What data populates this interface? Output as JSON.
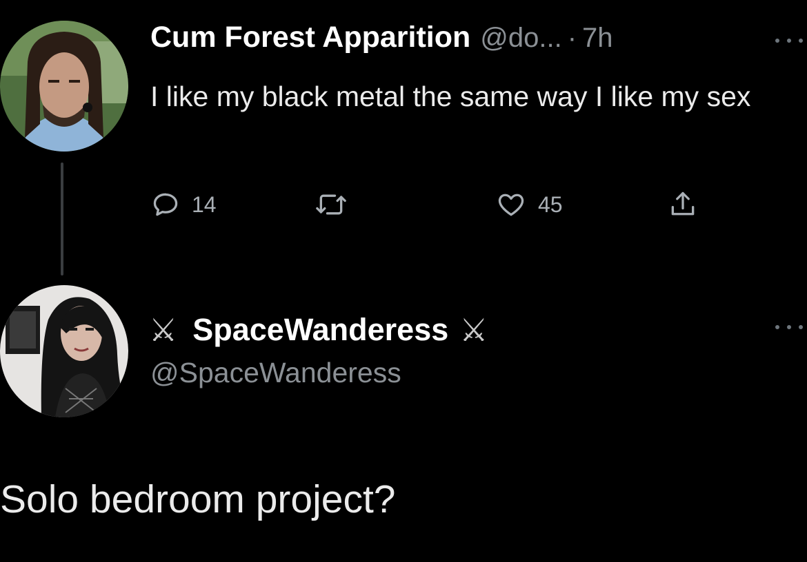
{
  "original_tweet": {
    "author_name": "Cum Forest Apparition",
    "author_handle": "@do...",
    "separator": "·",
    "timestamp": "7h",
    "text": "I like my black metal the same way I like my sex",
    "reply_count": "14",
    "retweet_count": "",
    "like_count": "45",
    "avatar_icon": "profile-photo-man-long-hair"
  },
  "reply_tweet": {
    "name_prefix_icon": "⚔",
    "author_name": "SpaceWanderess",
    "name_suffix_icon": "⚔",
    "author_handle": "@SpaceWanderess",
    "text": "Solo bedroom project?",
    "avatar_icon": "profile-photo-woman-dark-hair"
  },
  "colors": {
    "background": "#000000",
    "primary_text": "#e7e9ea",
    "secondary_text": "#8b9095",
    "thread_line": "#3a3d40"
  }
}
